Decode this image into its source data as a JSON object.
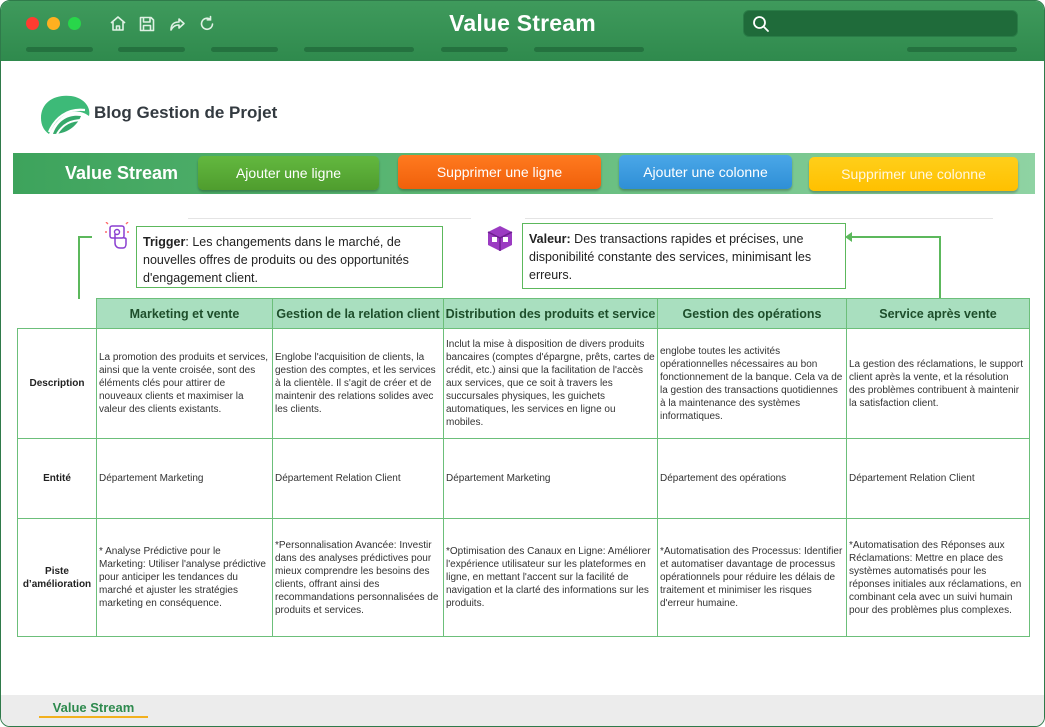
{
  "window": {
    "title": "Value Stream",
    "search": {
      "placeholder": ""
    }
  },
  "logo": {
    "text": "Blog Gestion de Projet"
  },
  "toolbar": {
    "title": "Value Stream",
    "add_row": "Ajouter une ligne",
    "delete_row": "Supprimer une ligne",
    "add_column": "Ajouter une colonne",
    "delete_column": "Supprimer une colonne"
  },
  "trigger": {
    "label": "Trigger",
    "text": ": Les changements dans le marché, de nouvelles offres de produits ou des opportunités d'engagement client."
  },
  "value": {
    "label": "Valeur:",
    "text": " Des transactions rapides et précises, une disponibilité constante des services, minimisant les erreurs."
  },
  "table": {
    "columns": [
      "Marketing et vente",
      "Gestion de la relation client",
      "Distribution des produits et service",
      "Gestion des opérations",
      "Service après vente"
    ],
    "rows": [
      {
        "label": "Description",
        "cells": [
          "La promotion des produits et services, ainsi que la vente croisée, sont des éléments clés pour attirer de nouveaux clients et maximiser la valeur des clients existants.",
          "Englobe l'acquisition de clients, la gestion des comptes, et les services à la clientèle. Il s'agit de créer et de maintenir des relations solides avec les clients.",
          "Inclut la mise à disposition de divers produits bancaires (comptes d'épargne, prêts, cartes de crédit, etc.) ainsi que la facilitation de l'accès aux services, que ce soit à travers les succursales physiques, les guichets automatiques, les services en ligne ou mobiles.",
          "englobe toutes les activités opérationnelles nécessaires au bon fonctionnement de la banque. Cela va de la gestion des transactions quotidiennes à la maintenance des systèmes informatiques.",
          "La gestion des réclamations, le support client après la vente, et la résolution des problèmes contribuent à maintenir la satisfaction client."
        ]
      },
      {
        "label": "Entité",
        "cells": [
          "Département Marketing",
          "Département Relation Client",
          "Département Marketing",
          "Département des opérations",
          "Département Relation Client"
        ]
      },
      {
        "label": "Piste d’amélioration",
        "cells": [
          "* Analyse Prédictive pour le Marketing: Utiliser l'analyse prédictive pour anticiper les tendances du marché et ajuster les stratégies marketing en conséquence.",
          "*Personnalisation Avancée: Investir dans des analyses prédictives pour mieux comprendre les besoins des clients, offrant ainsi des recommandations personnalisées de produits et services.",
          "*Optimisation des Canaux en Ligne: Améliorer l'expérience utilisateur sur les plateformes en ligne, en mettant l'accent sur la facilité de navigation et la clarté des informations sur les produits.",
          "*Automatisation des Processus: Identifier et automatiser davantage de processus opérationnels pour réduire les délais de traitement et minimiser les risques d'erreur humaine.",
          "*Automatisation des Réponses aux Réclamations: Mettre en place des systèmes automatisés pour les réponses initiales aux réclamations, en combinant cela avec un suivi humain pour des problèmes plus complexes."
        ]
      }
    ]
  },
  "sheet_tab": {
    "label": "Value Stream"
  },
  "colors": {
    "titlebar": "#3f9a5c",
    "header_fill": "#a9dfbf",
    "border": "#6cbf7a",
    "add_row": "#5aab36",
    "delete_row": "#f56a14",
    "add_column": "#3b9ee0",
    "delete_column": "#ffc40d",
    "tab_underline": "#f2b01e"
  }
}
